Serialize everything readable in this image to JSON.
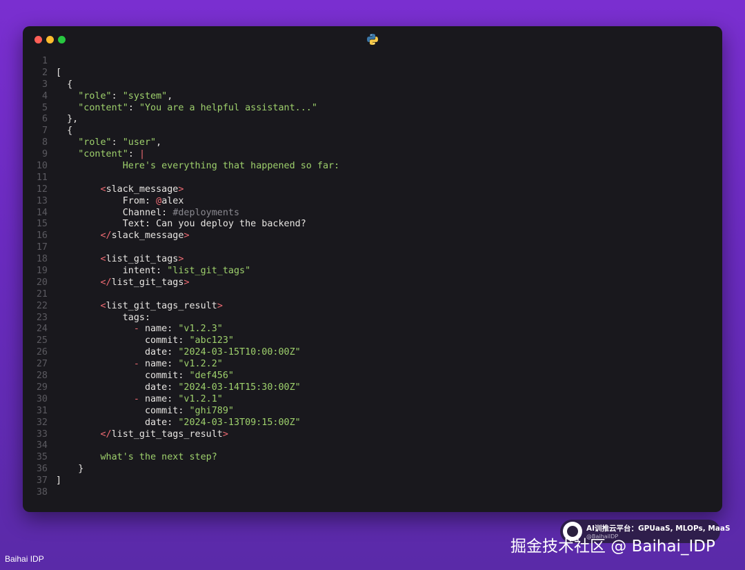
{
  "window": {
    "icon": "python-icon",
    "colors": {
      "background": "#19181d",
      "string": "#9ed06c",
      "accent": "#ef6b73",
      "line_number": "#5b5a60"
    }
  },
  "code": {
    "line_numbers": [
      "1",
      "2",
      "3",
      "4",
      "5",
      "6",
      "7",
      "8",
      "9",
      "10",
      "11",
      "12",
      "13",
      "14",
      "15",
      "16",
      "17",
      "18",
      "19",
      "20",
      "21",
      "22",
      "23",
      "24",
      "25",
      "26",
      "27",
      "28",
      "29",
      "30",
      "31",
      "32",
      "33",
      "34",
      "35",
      "36",
      "37",
      "38"
    ],
    "open_bracket": "[",
    "open_brace_1": "{",
    "key_role": "\"role\"",
    "val_system": "\"system\"",
    "key_content": "\"content\"",
    "val_system_content": "\"You are a helpful assistant...\"",
    "close_brace_comma": "},",
    "open_brace_2": "{",
    "val_user": "\"user\"",
    "pipe": "|",
    "intro": "Here's everything that happened so far:",
    "slack_tag": "slack_message",
    "from_label": "From: ",
    "from_at": "@",
    "from_name": "alex",
    "channel_label": "Channel: ",
    "channel_value": "#deployments",
    "text_line": "Text: Can you deploy the backend?",
    "list_tag": "list_git_tags",
    "intent_label": "intent: ",
    "intent_value": "\"list_git_tags\"",
    "result_tag": "list_git_tags_result",
    "tags_label": "tags:",
    "dash": "-",
    "name_label": "name: ",
    "commit_label": "commit: ",
    "date_label": "date: ",
    "tags": [
      {
        "name": "\"v1.2.3\"",
        "commit": "\"abc123\"",
        "date": "\"2024-03-15T10:00:00Z\""
      },
      {
        "name": "\"v1.2.2\"",
        "commit": "\"def456\"",
        "date": "\"2024-03-14T15:30:00Z\""
      },
      {
        "name": "\"v1.2.1\"",
        "commit": "\"ghi789\"",
        "date": "\"2024-03-13T09:15:00Z\""
      }
    ],
    "question": "what's the next step?",
    "close_brace": "}",
    "close_bracket": "]"
  },
  "watermark": {
    "badge_title": "AI训推云平台：GPUaaS, MLOPs, MaaS",
    "badge_sub": "@BaihaiIDP",
    "main": "掘金技术社区 @ Baihai_IDP",
    "corner": "Baihai IDP"
  }
}
